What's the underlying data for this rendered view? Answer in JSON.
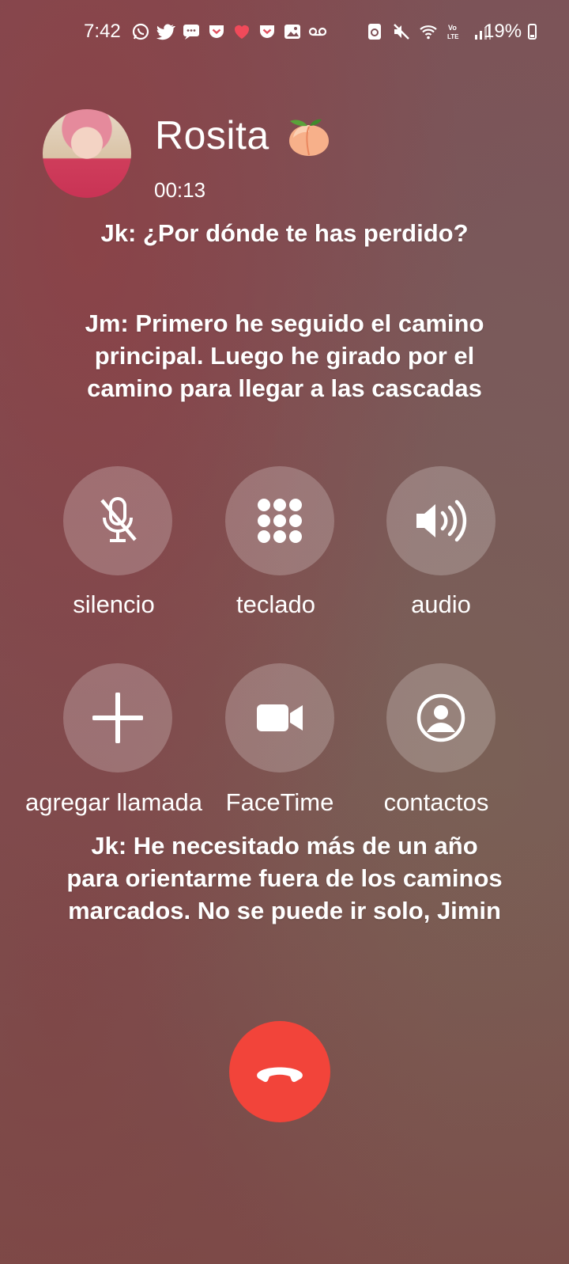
{
  "status_bar": {
    "time": "7:42",
    "battery": "19%",
    "left_icons": [
      "whatsapp-icon",
      "twitter-icon",
      "message-icon",
      "pocket-icon",
      "heart-icon",
      "pocket-icon",
      "gallery-icon",
      "voicemail-icon"
    ],
    "right_icons": [
      "data-saver-icon",
      "mute-icon",
      "wifi-icon",
      "volte-icon",
      "signal-icon"
    ]
  },
  "caller": {
    "name": "Rosita",
    "emoji": "peach-icon",
    "duration": "00:13"
  },
  "captions": {
    "first": "Jk: ¿Por dónde te has perdido?",
    "second": "Jm: Primero he seguido el camino principal. Luego he girado por el camino para llegar a las cascadas",
    "third": "Jk: He necesitado más de un año para orientarme fuera de los caminos marcados. No se puede ir solo, Jimin"
  },
  "controls": {
    "mute": "silencio",
    "keypad": "teclado",
    "audio": "audio",
    "add_call": "agregar llamada",
    "facetime": "FaceTime",
    "contacts": "contactos"
  },
  "colors": {
    "end_call": "#f2443a",
    "button_bg": "rgba(255,255,255,0.22)"
  }
}
